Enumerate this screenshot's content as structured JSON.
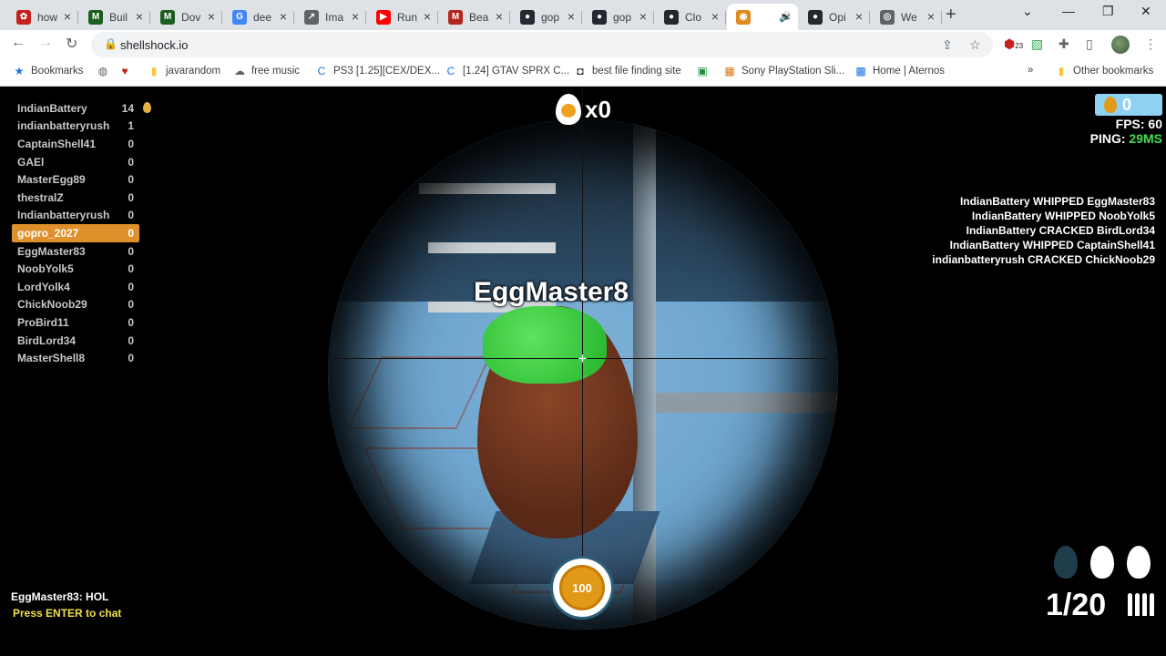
{
  "browser": {
    "tabs": [
      {
        "title": "how",
        "color": "#c5221f",
        "glyph": "✿"
      },
      {
        "title": "Buil",
        "color": "#1b5e20",
        "glyph": "M"
      },
      {
        "title": "Dov",
        "color": "#1b5e20",
        "glyph": "M"
      },
      {
        "title": "dee",
        "color": "#4285f4",
        "glyph": "G"
      },
      {
        "title": "Ima",
        "color": "#5f6368",
        "glyph": "↗"
      },
      {
        "title": "Run",
        "color": "#ff0000",
        "glyph": "▶"
      },
      {
        "title": "Bea",
        "color": "#b3261e",
        "glyph": "M"
      },
      {
        "title": "gop",
        "color": "#24292f",
        "glyph": "●"
      },
      {
        "title": "gop",
        "color": "#24292f",
        "glyph": "●"
      },
      {
        "title": "Clo",
        "color": "#24292f",
        "glyph": "●"
      },
      {
        "title": "",
        "color": "#e08a1e",
        "glyph": "◉",
        "active": true
      },
      {
        "title": "Opi",
        "color": "#24292f",
        "glyph": "●"
      },
      {
        "title": "We",
        "color": "#5f6368",
        "glyph": "◎"
      }
    ],
    "url": "shellshock.io",
    "extension_badge": "23",
    "bookmarks": [
      {
        "label": "Bookmarks",
        "icon": "★",
        "color": "#1a73e8"
      },
      {
        "label": "",
        "icon": "◍",
        "color": "#5f6368"
      },
      {
        "label": "",
        "icon": "♥",
        "color": "#c5221f"
      },
      {
        "label": "javarandom",
        "icon": "▮",
        "color": "#f9c440"
      },
      {
        "label": "free music",
        "icon": "☁",
        "color": "#5f6368"
      },
      {
        "label": "PS3 [1.25][CEX/DEX...",
        "icon": "C",
        "color": "#1a73e8"
      },
      {
        "label": "[1.24] GTAV SPRX C...",
        "icon": "C",
        "color": "#1a73e8"
      },
      {
        "label": "best file finding site",
        "icon": "◘",
        "color": "#202124"
      },
      {
        "label": "",
        "icon": "▣",
        "color": "#1e8e3e"
      },
      {
        "label": "Sony PlayStation Sli...",
        "icon": "▦",
        "color": "#e37400"
      },
      {
        "label": "Home | Aternos",
        "icon": "▩",
        "color": "#1a73e8"
      }
    ],
    "overflow": "»",
    "other_bookmarks": "Other bookmarks"
  },
  "game": {
    "scoreboard": [
      {
        "name": "IndianBattery",
        "score": "14"
      },
      {
        "name": "indianbatteryrush",
        "score": "1"
      },
      {
        "name": "CaptainShell41",
        "score": "0"
      },
      {
        "name": "GAEl",
        "score": "0"
      },
      {
        "name": "MasterEgg89",
        "score": "0"
      },
      {
        "name": "thestralZ",
        "score": "0"
      },
      {
        "name": "Indianbatteryrush",
        "score": "0"
      },
      {
        "name": "gopro_2027",
        "score": "0",
        "me": true
      },
      {
        "name": "EggMaster83",
        "score": "0"
      },
      {
        "name": "NoobYolk5",
        "score": "0"
      },
      {
        "name": "LordYolk4",
        "score": "0"
      },
      {
        "name": "ChickNoob29",
        "score": "0"
      },
      {
        "name": "ProBird11",
        "score": "0"
      },
      {
        "name": "BirdLord34",
        "score": "0"
      },
      {
        "name": "MasterShell8",
        "score": "0"
      }
    ],
    "kill_streak": "x0",
    "target_name": "EggMaster8",
    "eggs": "0",
    "fps_label": "FPS: 60",
    "ping_label": "PING:",
    "ping_value": "29MS",
    "killfeed": [
      "IndianBattery WHIPPED EggMaster83",
      "IndianBattery WHIPPED NoobYolk5",
      "IndianBattery CRACKED BirdLord34",
      "IndianBattery WHIPPED CaptainShell41",
      "indianbatteryrush CRACKED ChickNoob29"
    ],
    "chat_message": "EggMaster83: HOL",
    "chat_hint": "Press ENTER to chat",
    "health": "100",
    "ammo": "1/20",
    "grenades_available": 2,
    "grenades_total": 3
  }
}
